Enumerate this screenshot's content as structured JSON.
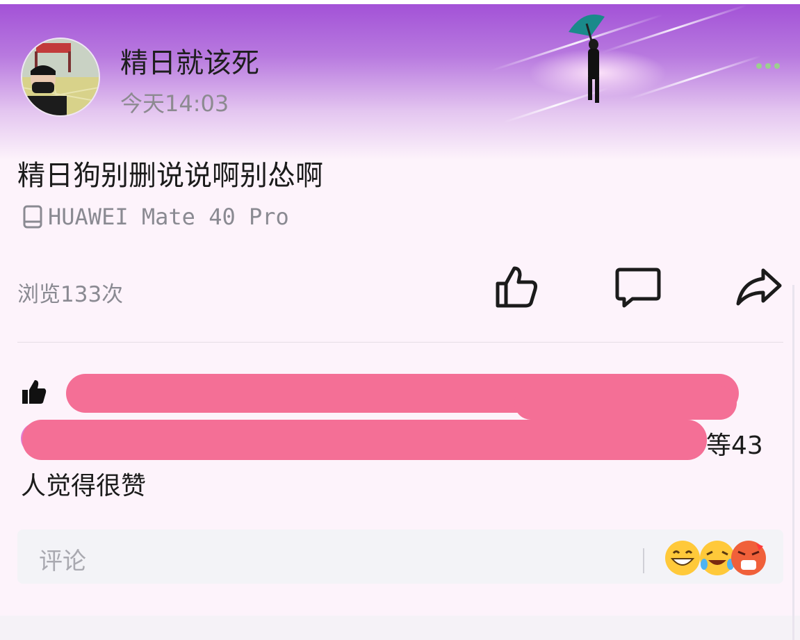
{
  "post": {
    "username": "精日就该死",
    "time": "今天14:03",
    "content": "精日狗别删说说啊别怂啊",
    "device": "HUAWEI Mate 40 Pro",
    "views": "浏览133次"
  },
  "likes": {
    "count_text": "等43",
    "line2": "人觉得很赞"
  },
  "comment": {
    "placeholder": "评论"
  },
  "icons": {
    "like": "thumbs-up-outline-icon",
    "comment": "comment-bubble-icon",
    "share": "share-arrow-icon",
    "device": "phone-icon",
    "likes_list": "thumbs-up-filled-icon",
    "emojis": [
      "grinning-face-icon",
      "tears-of-joy-icon",
      "angry-face-icon"
    ]
  },
  "colors": {
    "header_gradient_top": "#a14fd6",
    "redaction": "#f46f96",
    "background": "#fdf3fb"
  }
}
